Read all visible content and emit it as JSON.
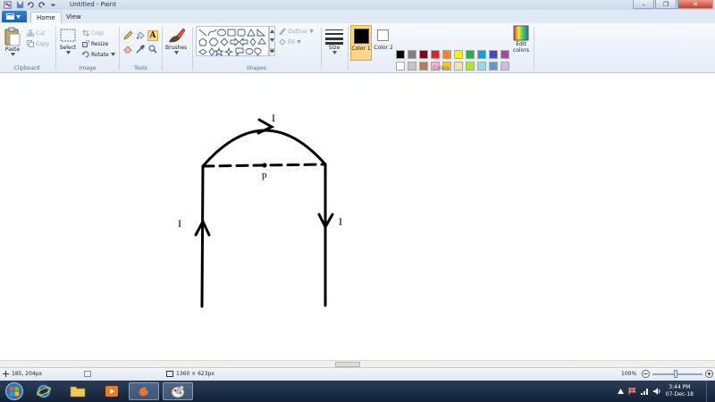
{
  "titlebar": {
    "title": "Untitled - Paint",
    "minimize": "–",
    "maximize": "❐",
    "close": "✕"
  },
  "tabs": {
    "file_label": "",
    "home": "Home",
    "view": "View"
  },
  "ribbon": {
    "clipboard": {
      "label": "Clipboard",
      "paste": "Paste",
      "cut": "Cut",
      "copy": "Copy"
    },
    "image": {
      "label": "Image",
      "select": "Select",
      "crop": "Crop",
      "resize": "Resize",
      "rotate": "Rotate"
    },
    "tools": {
      "label": "Tools",
      "text_tool": "A"
    },
    "brushes": {
      "label": "Brushes"
    },
    "shapes": {
      "label": "Shapes",
      "outline": "Outline",
      "fill": "Fill"
    },
    "size": {
      "label": "Size"
    },
    "colors": {
      "label": "Colors",
      "color1": "Color 1",
      "color2": "Color 2",
      "edit": "Edit colors",
      "color1_value": "#000000",
      "color2_value": "#ffffff",
      "palette_row1": [
        "#000000",
        "#7f7f7f",
        "#880015",
        "#ed1c24",
        "#ff7f27",
        "#fff200",
        "#22b14c",
        "#00a2e8",
        "#3f48cc",
        "#a349a4"
      ],
      "palette_row2": [
        "#ffffff",
        "#c3c3c3",
        "#b97a57",
        "#ffaec9",
        "#ffc90e",
        "#efe4b0",
        "#b5e61d",
        "#99d9ea",
        "#7092be",
        "#c8bfe7"
      ]
    }
  },
  "canvas": {
    "label_current_left": "I",
    "label_current_top": "I",
    "label_current_right": "I",
    "label_point": "p"
  },
  "status": {
    "cursor_pos": "185, 204px",
    "image_size": "1360 × 623px",
    "zoom": "100%"
  },
  "taskbar": {
    "time": "3:44 PM",
    "date": "07-Dec-18"
  }
}
